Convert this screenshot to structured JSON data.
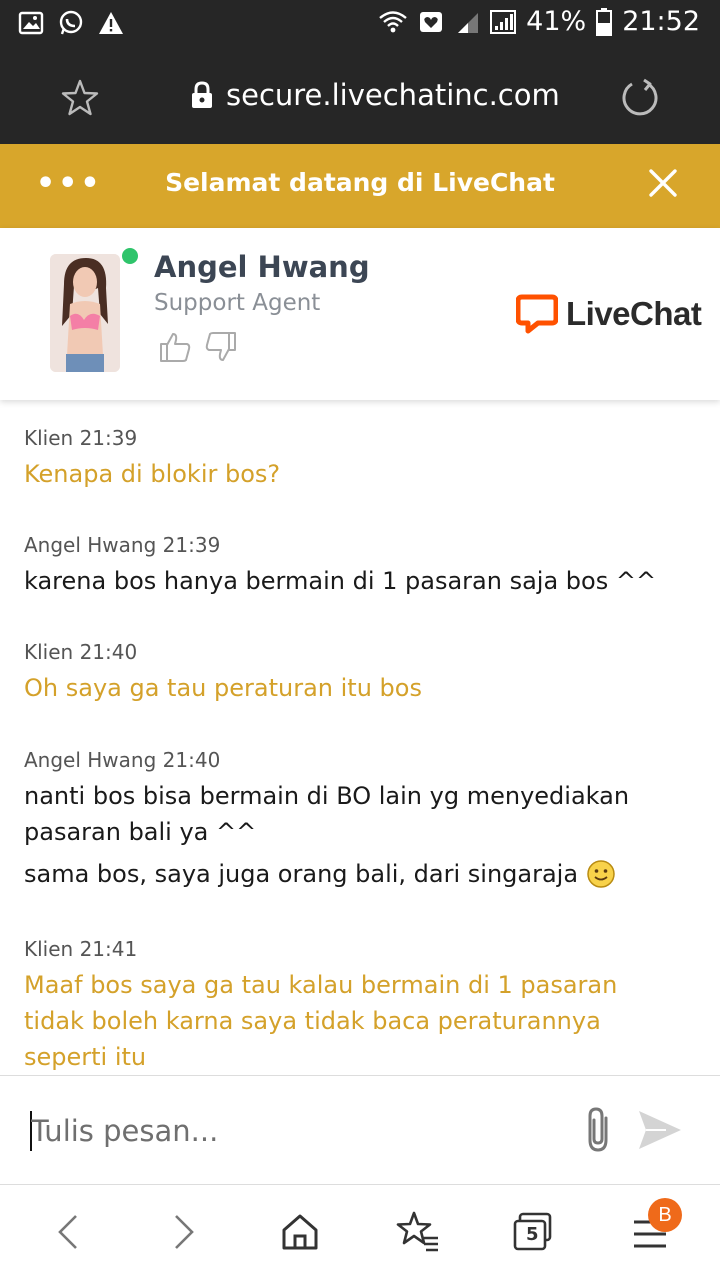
{
  "status_bar": {
    "battery": "41%",
    "time": "21:52",
    "icons": [
      "image-icon",
      "whatsapp-icon",
      "warning-icon",
      "wifi-icon",
      "heart-icon",
      "signal-icon",
      "signal-icon",
      "battery-icon"
    ]
  },
  "browser": {
    "url": "secure.livechatinc.com"
  },
  "livechat": {
    "menu_label": "•••",
    "header_title": "Selamat datang di LiveChat",
    "brand": "LiveChat",
    "accent_color": "#d8a62b",
    "brand_color": "#ff5100"
  },
  "agent": {
    "name": "Angel Hwang",
    "role": "Support Agent",
    "status": "online"
  },
  "messages": [
    {
      "author": "Klien",
      "time": "21:39",
      "type": "client",
      "lines": [
        "Kenapa di blokir bos?"
      ]
    },
    {
      "author": "Angel Hwang",
      "time": "21:39",
      "type": "agent",
      "lines": [
        "karena bos hanya bermain di 1 pasaran saja bos ^^"
      ]
    },
    {
      "author": "Klien",
      "time": "21:40",
      "type": "client",
      "lines": [
        "Oh saya ga tau peraturan itu bos"
      ]
    },
    {
      "author": "Angel Hwang",
      "time": "21:40",
      "type": "agent",
      "lines": [
        "nanti bos bisa bermain di BO lain yg menyediakan pasaran bali ya ^^",
        "sama bos, saya juga orang bali, dari singaraja"
      ]
    },
    {
      "author": "Klien",
      "time": "21:41",
      "type": "client",
      "lines": [
        "Maaf bos saya ga tau kalau bermain di 1 pasaran tidak boleh karna saya tidak baca peraturannya seperti itu"
      ]
    }
  ],
  "composer": {
    "placeholder": "Tulis pesan..."
  },
  "bottom_nav": {
    "tab_count": "5",
    "badge": "B"
  }
}
